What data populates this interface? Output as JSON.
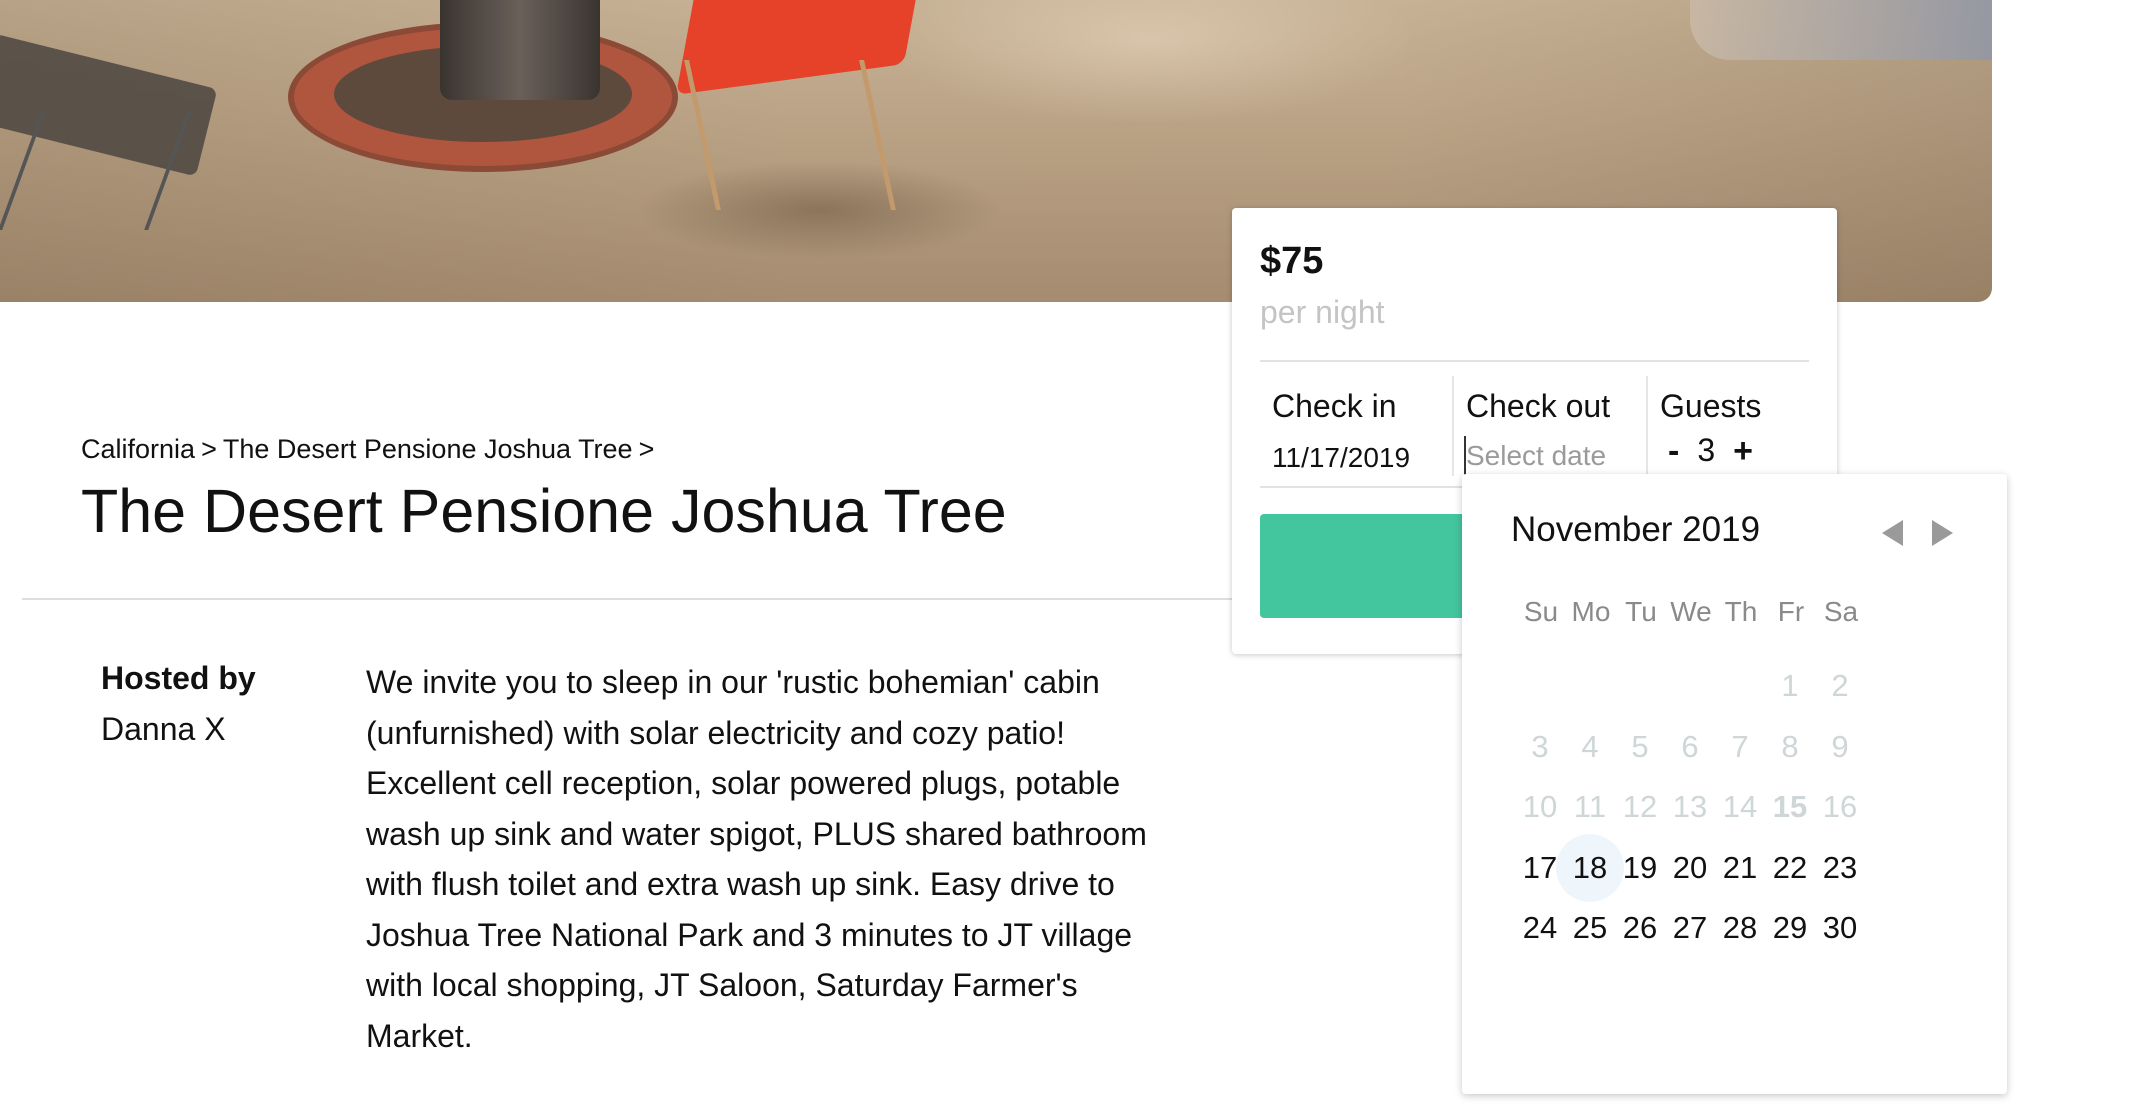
{
  "listing": {
    "breadcrumb": [
      "California",
      ">",
      "The Desert Pensione Joshua Tree",
      ">"
    ],
    "title": "The Desert Pensione Joshua Tree",
    "hosted_by_label": "Hosted by",
    "host_name": "Danna X",
    "description": "We invite you to sleep in our 'rustic bohemian' cabin (unfurnished) with solar electricity and cozy patio! Excellent cell reception, solar powered plugs, potable wash up sink and water spigot, PLUS shared bathroom with flush toilet and extra wash up sink. Easy drive to Joshua Tree National Park and 3 minutes to JT village with local shopping, JT Saloon, Saturday Farmer's Market."
  },
  "booking": {
    "price": "$75",
    "per_night": "per night",
    "check_in_label": "Check in",
    "check_in_value": "11/17/2019",
    "check_out_label": "Check out",
    "check_out_placeholder": "Select date",
    "guests_label": "Guests",
    "guests_minus": "-",
    "guests_count": "3",
    "guests_plus": "+",
    "accent_color": "#43c59e"
  },
  "calendar": {
    "month_label": "November 2019",
    "weekdays": [
      "Su",
      "Mo",
      "Tu",
      "We",
      "Th",
      "Fr",
      "Sa"
    ],
    "weeks": [
      [
        "",
        "",
        "",
        "",
        "",
        "1",
        "2"
      ],
      [
        "3",
        "4",
        "5",
        "6",
        "7",
        "8",
        "9"
      ],
      [
        "10",
        "11",
        "12",
        "13",
        "14",
        "15",
        "16"
      ],
      [
        "17",
        "18",
        "19",
        "20",
        "21",
        "22",
        "23"
      ],
      [
        "24",
        "25",
        "26",
        "27",
        "28",
        "29",
        "30"
      ]
    ],
    "disabled_through": 16,
    "today": 15,
    "highlighted": 18,
    "prev_icon": "triangle-left-icon",
    "next_icon": "triangle-right-icon"
  }
}
